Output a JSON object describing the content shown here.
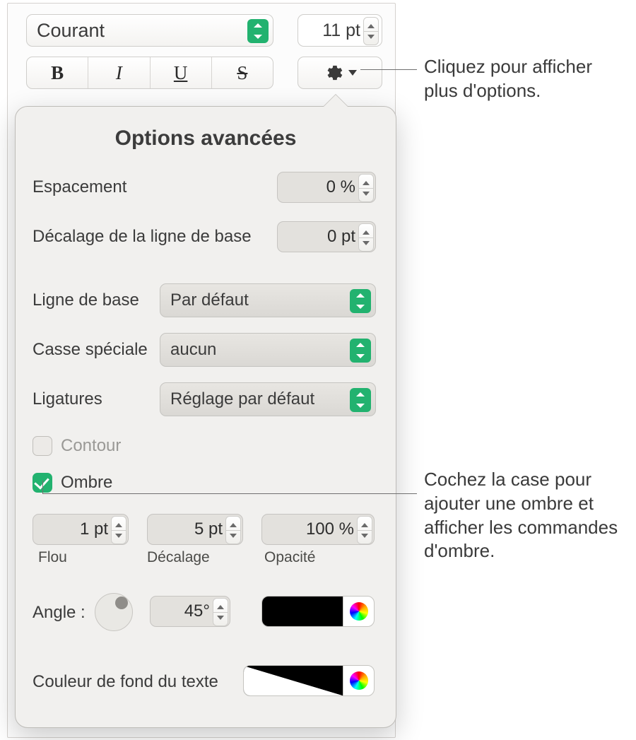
{
  "toolbar": {
    "font": "Courant",
    "size": "11 pt",
    "bold": "B",
    "italic": "I",
    "underline": "U",
    "strike": "S",
    "gear_icon": "gear-icon"
  },
  "popover": {
    "title": "Options avancées",
    "spacing_label": "Espacement",
    "spacing_value": "0 %",
    "baseline_offset_label": "Décalage de la ligne de base",
    "baseline_offset_value": "0 pt",
    "baseline_label": "Ligne de base",
    "baseline_select": "Par défaut",
    "case_label": "Casse spéciale",
    "case_select": "aucun",
    "ligatures_label": "Ligatures",
    "ligatures_select": "Réglage par défaut",
    "contour_label": "Contour",
    "shadow_label": "Ombre",
    "shadow_checked": true,
    "blur_value": "1 pt",
    "blur_label": "Flou",
    "offset_value": "5 pt",
    "offset_label": "Décalage",
    "opacity_value": "100 %",
    "opacity_label": "Opacité",
    "angle_label": "Angle :",
    "angle_value": "45°",
    "bgtext_label": "Couleur de fond du texte",
    "shadow_color": "#000000"
  },
  "callouts": {
    "c1": "Cliquez pour afficher plus d'options.",
    "c2": "Cochez la case pour ajouter une ombre et afficher les commandes d'ombre."
  }
}
